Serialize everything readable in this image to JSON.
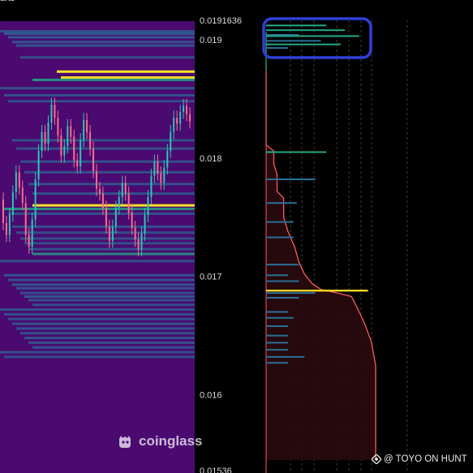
{
  "header_fragment": "arts",
  "watermark": {
    "text": "coinglass",
    "icon": "coinglass-logo-icon"
  },
  "credit": {
    "text": "@ TOYO ON HUNT",
    "icon": "binance-diamond-icon"
  },
  "colors": {
    "heatmap_background": "#4a0a70",
    "liquidity_low": "#2a6f97",
    "liquidity_mid": "#22a884",
    "liquidity_high": "#fde725",
    "candle_up": "#2ec4b6",
    "candle_down": "#ff6b8b",
    "depth_line": "#ff5a5a",
    "depth_fill": "#2a0a0e",
    "current_level": "#f5d623",
    "annotation": "#2f3fd8"
  },
  "chart_data": {
    "type": "heatmap",
    "title": "",
    "xlabel": "",
    "ylabel": "",
    "ylim": [
      0.01536,
      0.0191636
    ],
    "y_ticks": [
      "0.0191636",
      "0.019",
      "0.018",
      "0.017",
      "0.016",
      "0.01536"
    ],
    "y_tick_values": [
      0.0191636,
      0.019,
      0.018,
      0.017,
      0.016,
      0.01536
    ],
    "heatmap_levels": [
      {
        "price": 0.01907,
        "intensity": 0.35
      },
      {
        "price": 0.01905,
        "intensity": 0.45
      },
      {
        "price": 0.01902,
        "intensity": 0.4
      },
      {
        "price": 0.01898,
        "intensity": 0.4
      },
      {
        "price": 0.01895,
        "intensity": 0.35
      },
      {
        "price": 0.01885,
        "intensity": 0.25
      },
      {
        "price": 0.01873,
        "intensity": 1.0
      },
      {
        "price": 0.01868,
        "intensity": 0.85
      },
      {
        "price": 0.01866,
        "intensity": 0.65
      },
      {
        "price": 0.01859,
        "intensity": 0.35
      },
      {
        "price": 0.01853,
        "intensity": 0.3
      },
      {
        "price": 0.01848,
        "intensity": 0.25
      },
      {
        "price": 0.01815,
        "intensity": 0.3
      },
      {
        "price": 0.01808,
        "intensity": 0.25
      },
      {
        "price": 0.01797,
        "intensity": 0.3
      },
      {
        "price": 0.01788,
        "intensity": 0.3
      },
      {
        "price": 0.01778,
        "intensity": 0.25
      },
      {
        "price": 0.0177,
        "intensity": 0.3
      },
      {
        "price": 0.0176,
        "intensity": 0.95
      },
      {
        "price": 0.01757,
        "intensity": 0.6
      },
      {
        "price": 0.01753,
        "intensity": 0.35
      },
      {
        "price": 0.01742,
        "intensity": 0.25
      },
      {
        "price": 0.01737,
        "intensity": 0.25
      },
      {
        "price": 0.01732,
        "intensity": 0.25
      },
      {
        "price": 0.01728,
        "intensity": 0.25
      },
      {
        "price": 0.01723,
        "intensity": 0.3
      },
      {
        "price": 0.01719,
        "intensity": 0.5
      },
      {
        "price": 0.01713,
        "intensity": 0.3
      },
      {
        "price": 0.01701,
        "intensity": 0.35
      },
      {
        "price": 0.01697,
        "intensity": 0.3
      },
      {
        "price": 0.01693,
        "intensity": 0.4
      },
      {
        "price": 0.0169,
        "intensity": 0.3
      },
      {
        "price": 0.01686,
        "intensity": 0.3
      },
      {
        "price": 0.01683,
        "intensity": 0.4
      },
      {
        "price": 0.0168,
        "intensity": 0.3
      },
      {
        "price": 0.01676,
        "intensity": 0.35
      },
      {
        "price": 0.01672,
        "intensity": 0.3
      },
      {
        "price": 0.01668,
        "intensity": 0.3
      },
      {
        "price": 0.01664,
        "intensity": 0.3
      },
      {
        "price": 0.0166,
        "intensity": 0.3
      },
      {
        "price": 0.01656,
        "intensity": 0.3
      },
      {
        "price": 0.01652,
        "intensity": 0.3
      },
      {
        "price": 0.01648,
        "intensity": 0.3
      },
      {
        "price": 0.01644,
        "intensity": 0.3
      },
      {
        "price": 0.0164,
        "intensity": 0.3
      },
      {
        "price": 0.01636,
        "intensity": 0.3
      },
      {
        "price": 0.01632,
        "intensity": 0.3
      }
    ],
    "price_path": [
      0.01765,
      0.01745,
      0.01735,
      0.01752,
      0.01771,
      0.01788,
      0.01775,
      0.01762,
      0.01735,
      0.01725,
      0.01748,
      0.01782,
      0.01806,
      0.01822,
      0.01812,
      0.0183,
      0.01845,
      0.01834,
      0.01819,
      0.01802,
      0.0181,
      0.01827,
      0.01818,
      0.01798,
      0.01793,
      0.01815,
      0.01832,
      0.01822,
      0.01808,
      0.01789,
      0.01774,
      0.0177,
      0.01758,
      0.01742,
      0.0173,
      0.01742,
      0.01758,
      0.01767,
      0.01779,
      0.0177,
      0.01754,
      0.01741,
      0.01731,
      0.01723,
      0.01736,
      0.01752,
      0.01767,
      0.01785,
      0.01797,
      0.01787,
      0.01779,
      0.01792,
      0.01806,
      0.01822,
      0.01834,
      0.01829,
      0.01839,
      0.01844,
      0.01837,
      0.01831
    ],
    "depth_bars": [
      {
        "price": 0.01917,
        "size": 0.05
      },
      {
        "price": 0.01912,
        "size": 0.55
      },
      {
        "price": 0.01908,
        "size": 0.72
      },
      {
        "price": 0.01904,
        "size": 0.3
      },
      {
        "price": 0.01903,
        "size": 0.85
      },
      {
        "price": 0.01899,
        "size": 0.5
      },
      {
        "price": 0.01896,
        "size": 0.68
      },
      {
        "price": 0.01893,
        "size": 0.2
      },
      {
        "price": 0.01805,
        "size": 0.55
      },
      {
        "price": 0.01782,
        "size": 0.45
      },
      {
        "price": 0.01762,
        "size": 0.28
      },
      {
        "price": 0.01746,
        "size": 0.25
      },
      {
        "price": 0.01733,
        "size": 0.25
      },
      {
        "price": 0.0171,
        "size": 0.3
      },
      {
        "price": 0.01701,
        "size": 0.2
      },
      {
        "price": 0.01696,
        "size": 0.3
      },
      {
        "price": 0.01686,
        "size": 0.45
      },
      {
        "price": 0.01682,
        "size": 0.3
      },
      {
        "price": 0.0167,
        "size": 0.2
      },
      {
        "price": 0.01665,
        "size": 0.25
      },
      {
        "price": 0.01658,
        "size": 0.2
      },
      {
        "price": 0.0165,
        "size": 0.2
      },
      {
        "price": 0.01644,
        "size": 0.2
      },
      {
        "price": 0.01638,
        "size": 0.2
      },
      {
        "price": 0.01632,
        "size": 0.35
      },
      {
        "price": 0.01627,
        "size": 0.2
      }
    ],
    "cumulative_depth": [
      {
        "price": 0.01874,
        "size": 0.0
      },
      {
        "price": 0.01811,
        "size": 0.0
      },
      {
        "price": 0.01806,
        "size": 0.07
      },
      {
        "price": 0.01795,
        "size": 0.07
      },
      {
        "price": 0.01786,
        "size": 0.1
      },
      {
        "price": 0.01772,
        "size": 0.1
      },
      {
        "price": 0.01766,
        "size": 0.16
      },
      {
        "price": 0.0175,
        "size": 0.16
      },
      {
        "price": 0.01738,
        "size": 0.2
      },
      {
        "price": 0.01725,
        "size": 0.26
      },
      {
        "price": 0.01712,
        "size": 0.3
      },
      {
        "price": 0.01702,
        "size": 0.35
      },
      {
        "price": 0.01694,
        "size": 0.42
      },
      {
        "price": 0.01689,
        "size": 0.5
      },
      {
        "price": 0.01686,
        "size": 0.65
      },
      {
        "price": 0.01683,
        "size": 0.78
      },
      {
        "price": 0.0167,
        "size": 0.85
      },
      {
        "price": 0.0166,
        "size": 0.9
      },
      {
        "price": 0.01645,
        "size": 0.96
      },
      {
        "price": 0.01625,
        "size": 1.0
      },
      {
        "price": 0.01545,
        "size": 1.0
      }
    ],
    "current_level": {
      "price": 0.01688,
      "size": 0.93
    },
    "annotation": "box around order book top near 0.019"
  }
}
